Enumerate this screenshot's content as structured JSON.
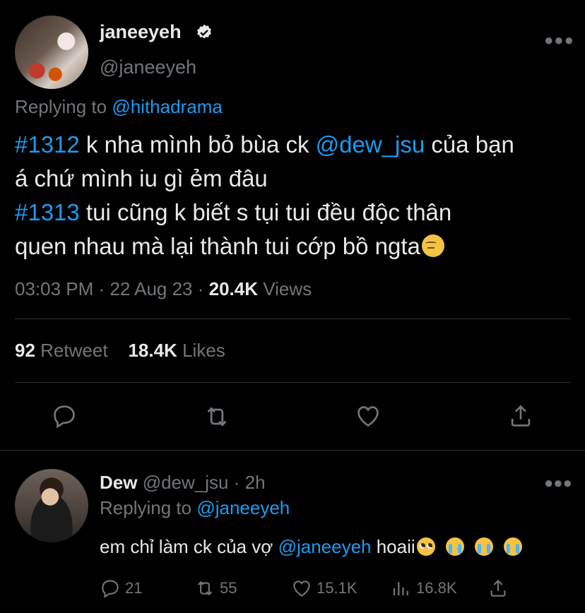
{
  "tweet": {
    "display_name": "janeeyeh",
    "handle": "@janeeyeh",
    "replying_label": "Replying to",
    "replying_to": "@hithadrama",
    "lines": [
      {
        "tag": "#1312",
        "t1": " k nha mình bỏ bùa ck ",
        "mention": "@dew_jsu",
        "t2": " của bạn"
      },
      {
        "text": "á chứ mình iu gì ẻm đâu"
      },
      {
        "tag": "#1313",
        "t1": " tui cũng k biết s tụi tui đều độc thân"
      },
      {
        "text": "quen nhau mà lại thành tui cớp bồ ngta"
      }
    ],
    "time": "03:03 PM",
    "date": "22 Aug 23",
    "views_count": "20.4K",
    "views_label": "Views",
    "retweets_count": "92",
    "retweets_label": "Retweet",
    "likes_count": "18.4K",
    "likes_label": "Likes",
    "more_icon": "more-icon"
  },
  "reply": {
    "display_name": "Dew",
    "handle": "@dew_jsu",
    "separator": "·",
    "age": "2h",
    "replying_label": "Replying to",
    "replying_to": "@janeeyeh",
    "text_before": "em chỉ làm ck của vợ ",
    "mention": "@janeeyeh",
    "text_after": " hoaii",
    "reply_count": "21",
    "retweet_count": "55",
    "like_count": "15.1K",
    "view_count": "16.8K"
  }
}
